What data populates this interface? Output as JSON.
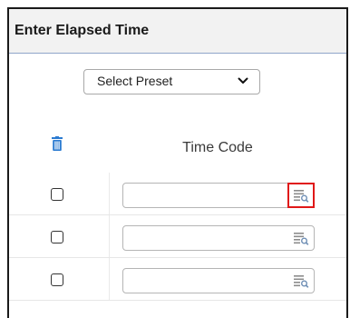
{
  "panel": {
    "title": "Enter Elapsed Time"
  },
  "preset": {
    "selected": "Select Preset",
    "icon": "chevron-down-icon"
  },
  "table": {
    "delete_icon": "trash-icon",
    "column_header": "Time Code",
    "rows": [
      {
        "checked": false,
        "value": "",
        "lookup_icon": "lookup-icon",
        "highlighted": true
      },
      {
        "checked": false,
        "value": "",
        "lookup_icon": "lookup-icon",
        "highlighted": false
      },
      {
        "checked": false,
        "value": "",
        "lookup_icon": "lookup-icon",
        "highlighted": false
      }
    ]
  },
  "colors": {
    "highlight": "#e01818",
    "trash_icon": "#2b7bd1",
    "header_bg": "#f2f2f2",
    "header_border": "#8fa6c9"
  }
}
